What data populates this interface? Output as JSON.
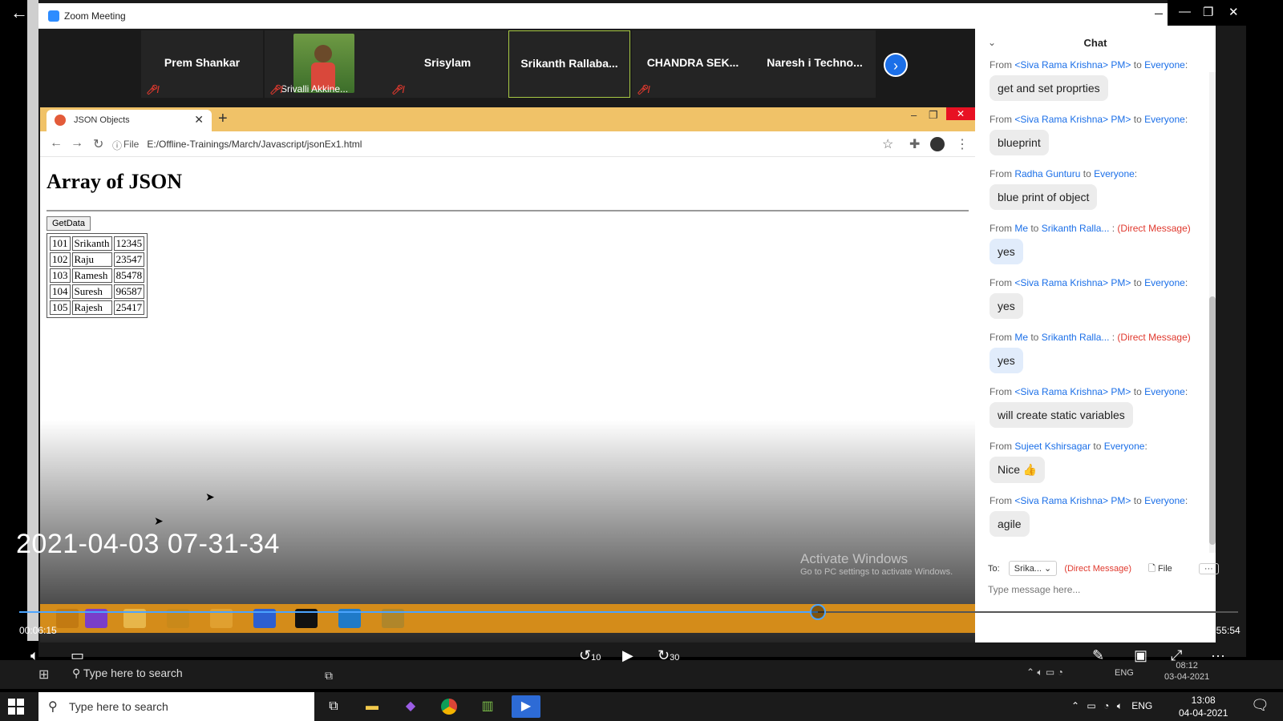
{
  "zoom": {
    "title": "Zoom Meeting",
    "participants": [
      {
        "name": "Prem Shankar",
        "muted": true
      },
      {
        "name": "Srivalli Akkine...",
        "muted": true,
        "has_video": true
      },
      {
        "name": "Srisylam",
        "muted": true
      },
      {
        "name": "Srikanth  Rallaba...",
        "muted": false,
        "active": true
      },
      {
        "name": "CHANDRA SEK...",
        "muted": true
      },
      {
        "name": "Naresh i Techno...",
        "muted": false
      }
    ]
  },
  "browser": {
    "tab_title": "JSON Objects",
    "file_label": "File",
    "url": "E:/Offline-Trainings/March/Javascript/jsonEx1.html"
  },
  "page": {
    "heading": "Array of JSON",
    "button_label": "GetData",
    "rows": [
      [
        "101",
        "Srikanth",
        "12345"
      ],
      [
        "102",
        "Raju",
        "23547"
      ],
      [
        "103",
        "Ramesh",
        "85478"
      ],
      [
        "104",
        "Suresh",
        "96587"
      ],
      [
        "105",
        "Rajesh",
        "25417"
      ]
    ]
  },
  "overlay": {
    "timestamp": "2021-04-03 07-31-34",
    "activate_title": "Activate Windows",
    "activate_sub": "Go to PC settings to activate Windows."
  },
  "chat": {
    "title": "Chat",
    "messages": [
      {
        "from": "<Siva Rama Krishna> PM>",
        "to": "Everyone",
        "text": "get and set proprties"
      },
      {
        "from": "<Siva Rama Krishna> PM>",
        "to": "Everyone",
        "text": "blueprint"
      },
      {
        "from": "Radha Gunturu",
        "to": "Everyone",
        "text": "blue print of object"
      },
      {
        "from": "Me",
        "to": "Srikanth Ralla...",
        "dm": "(Direct Message)",
        "text": "yes"
      },
      {
        "from": "<Siva Rama Krishna> PM>",
        "to": "Everyone",
        "text": "yes"
      },
      {
        "from": "Me",
        "to": "Srikanth Ralla...",
        "dm": "(Direct Message)",
        "text": "yes"
      },
      {
        "from": "<Siva Rama Krishna> PM>",
        "to": "Everyone",
        "text": "will create static variables"
      },
      {
        "from": "Sujeet Kshirsagar",
        "to": "Everyone",
        "text": "Nice 👍"
      },
      {
        "from": "<Siva Rama Krishna> PM>",
        "to": "Everyone",
        "text": "agile"
      }
    ],
    "to_label": "To:",
    "to_value": "Srika...",
    "dm_label": "(Direct Message)",
    "file_label": "File",
    "input_placeholder": "Type message here..."
  },
  "player": {
    "elapsed": "00:06:15",
    "total": "00:55:54",
    "progress": 0.655,
    "skip_back": "10",
    "skip_fwd": "30"
  },
  "inner_taskbar": {
    "search_placeholder": "Type here to search",
    "lang": "ENG",
    "time": "08:12",
    "date": "03-04-2021"
  },
  "taskbar": {
    "search_placeholder": "Type here to search",
    "lang": "ENG",
    "time": "13:08",
    "date": "04-04-2021"
  }
}
